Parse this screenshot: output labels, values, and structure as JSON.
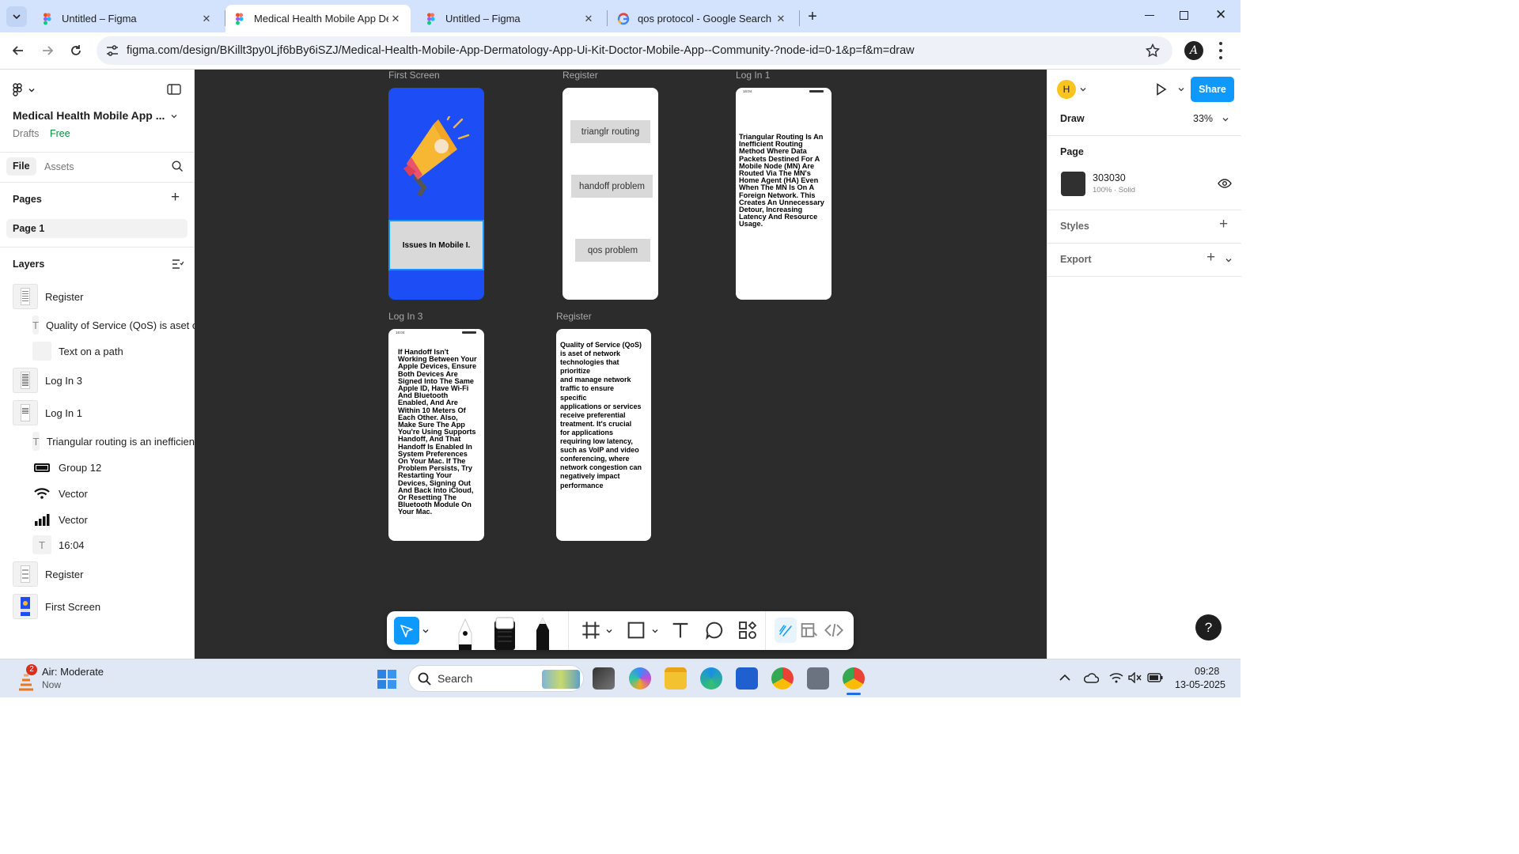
{
  "browser": {
    "tabs": [
      {
        "title": "Untitled – Figma",
        "active": false
      },
      {
        "title": "Medical Health Mobile App Der",
        "active": true
      },
      {
        "title": "Untitled – Figma",
        "active": false
      },
      {
        "title": "qos protocol - Google Search",
        "active": false
      }
    ],
    "url": "figma.com/design/BKillt3py0Ljf6bBy6iSZJ/Medical-Health-Mobile-App-Dermatology-App-Ui-Kit-Doctor-Mobile-App--Community-?node-id=0-1&p=f&m=draw",
    "profile_initial": "A"
  },
  "left_panel": {
    "file_name": "Medical Health Mobile App ...",
    "drafts": "Drafts",
    "plan_badge": "Free",
    "tab_file": "File",
    "tab_assets": "Assets",
    "pages_heading": "Pages",
    "pages": [
      "Page 1"
    ],
    "layers_heading": "Layers",
    "layers": [
      {
        "name": "Register",
        "kind": "frame"
      },
      {
        "name": "Quality of Service (QoS) is aset o",
        "kind": "text"
      },
      {
        "name": "Text on a path",
        "kind": "blank"
      },
      {
        "name": "Log In 3",
        "kind": "frame"
      },
      {
        "name": "Log In 1",
        "kind": "frame"
      },
      {
        "name": "Triangular routing is an inefficien",
        "kind": "text"
      },
      {
        "name": "Group 12",
        "kind": "battery"
      },
      {
        "name": "Vector",
        "kind": "wifi"
      },
      {
        "name": "Vector",
        "kind": "signal"
      },
      {
        "name": "16:04",
        "kind": "text"
      },
      {
        "name": "Register",
        "kind": "frame"
      },
      {
        "name": "First Screen",
        "kind": "frame-blue"
      }
    ]
  },
  "canvas": {
    "frames": {
      "first_screen": {
        "label": "First Screen",
        "caption": "Issues In Mobile I."
      },
      "register_top": {
        "label": "Register",
        "buttons": [
          "trianglr routing",
          "handoff problem",
          "qos problem"
        ]
      },
      "login1": {
        "label": "Log In 1",
        "time": "16:04",
        "text": "Triangular Routing Is An Inefficient Routing Method Where Data Packets Destined For A Mobile Node (MN) Are Routed Via The MN's Home Agent (HA) Even When The MN Is On A Foreign Network. This Creates An Unnecessary Detour, Increasing Latency And Resource Usage."
      },
      "login3": {
        "label": "Log In 3",
        "time": "16:04",
        "text": "If Handoff Isn't Working Between Your Apple Devices, Ensure Both Devices Are Signed Into The Same Apple ID, Have Wi-Fi And Bluetooth Enabled, And Are Within 10 Meters Of Each Other. Also, Make Sure The App You're Using Supports Handoff, And That Handoff Is Enabled In System Preferences On Your Mac. If The Problem Persists, Try Restarting Your Devices, Signing Out And Back Into iCloud, Or Resetting The Bluetooth Module On Your Mac."
      },
      "register_bottom": {
        "label": "Register",
        "text": "Quality of Service (QoS)\n is aset of network\n technologies that prioritize\nand manage network traffic to ensure specific\n applications or services\nreceive preferential\n treatment. It's crucial for applications requiring low latency, such as VoIP and video conferencing, where network congestion can negatively impact performance"
      }
    }
  },
  "right_panel": {
    "avatar_initial": "H",
    "share_label": "Share",
    "mode_label": "Draw",
    "zoom": "33%",
    "page_heading": "Page",
    "page_color_hex": "303030",
    "page_color_sub": "100% · Solid",
    "styles_heading": "Styles",
    "export_heading": "Export",
    "help_label": "?"
  },
  "taskbar": {
    "weather_badge": "2",
    "weather_title": "Air: Moderate",
    "weather_sub": "Now",
    "search_label": "Search",
    "time": "09:28",
    "date": "13-05-2025"
  },
  "colors": {
    "canvas_bg": "#2c2c2c",
    "first_screen_blue": "#1d4ef5",
    "figma_blue": "#0d99ff",
    "tab_strip": "#d3e3fd",
    "page_swatch": "#303030"
  }
}
